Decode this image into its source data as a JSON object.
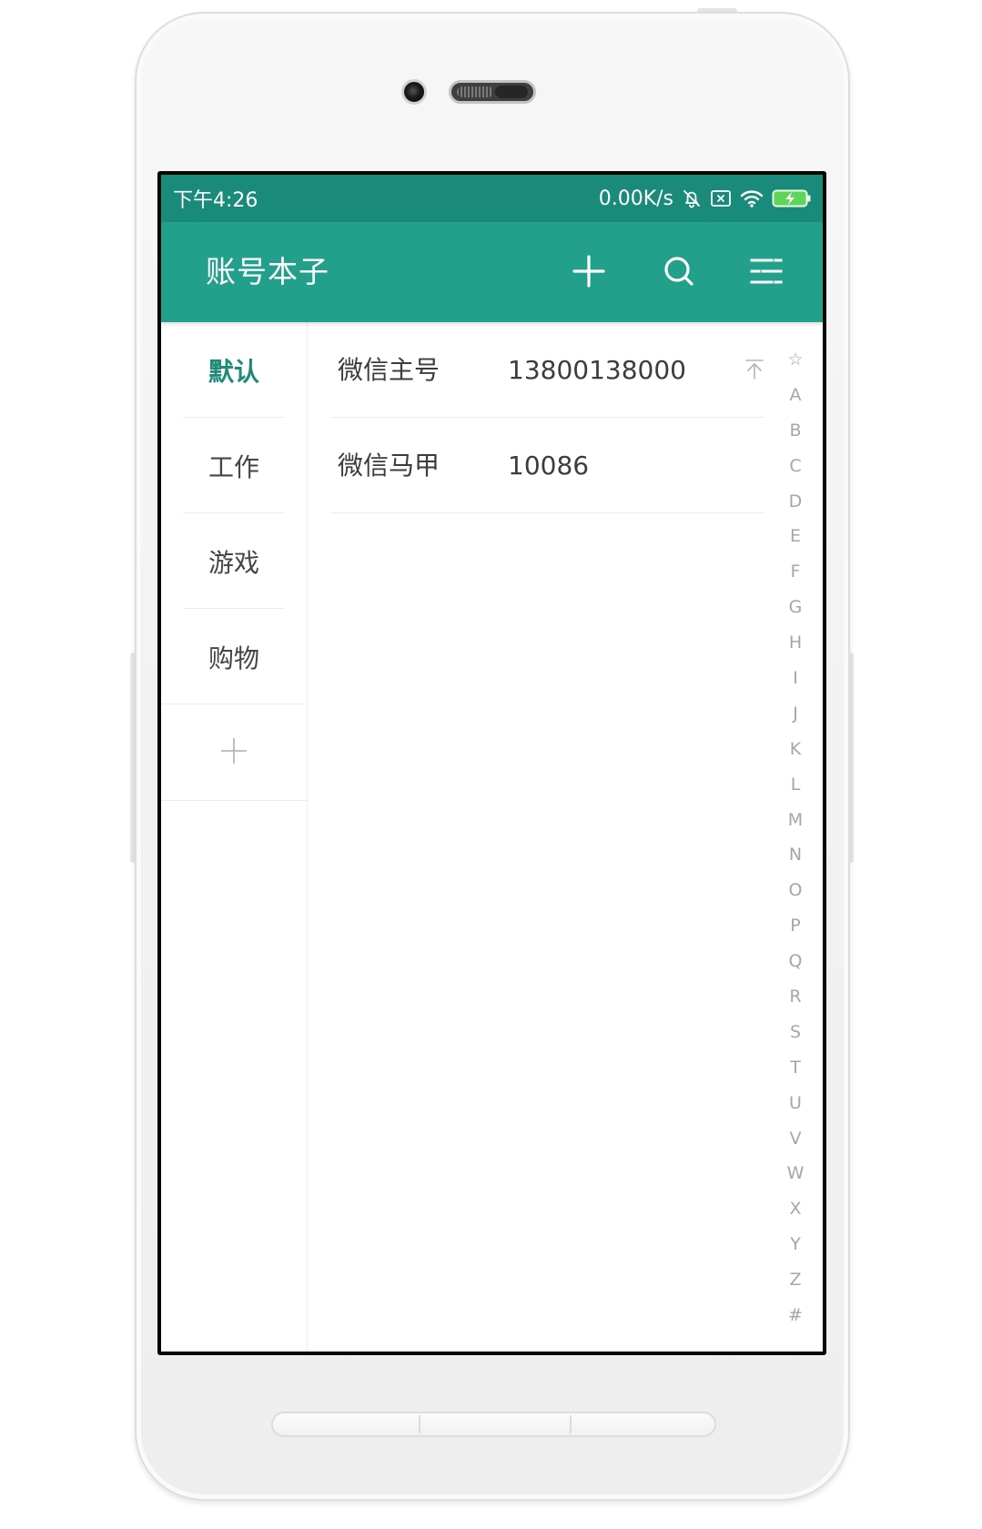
{
  "status_bar": {
    "time": "下午4:26",
    "net_speed": "0.00K/s",
    "icons": [
      "bell-muted-icon",
      "data-disabled-icon",
      "wifi-icon",
      "battery-charging-icon"
    ]
  },
  "app_bar": {
    "title": "账号本子",
    "actions": [
      "plus-icon",
      "search-icon",
      "filter-menu-icon"
    ]
  },
  "sidebar": {
    "categories": [
      {
        "label": "默认",
        "selected": true
      },
      {
        "label": "工作",
        "selected": false
      },
      {
        "label": "游戏",
        "selected": false
      },
      {
        "label": "购物",
        "selected": false
      }
    ],
    "add_icon": "plus-icon"
  },
  "accounts": [
    {
      "name": "微信主号",
      "account": "13800138000",
      "action_icon": "move-to-top-icon"
    },
    {
      "name": "微信马甲",
      "account": "10086"
    }
  ],
  "index_bar": [
    "☆",
    "A",
    "B",
    "C",
    "D",
    "E",
    "F",
    "G",
    "H",
    "I",
    "J",
    "K",
    "L",
    "M",
    "N",
    "O",
    "P",
    "Q",
    "R",
    "S",
    "T",
    "U",
    "V",
    "W",
    "X",
    "Y",
    "Z",
    "#"
  ],
  "colors": {
    "status_bar": "#1a8b7a",
    "app_bar": "#22a08b",
    "accent": "#1c8c79",
    "text": "#3c3c3c",
    "index_text": "#a6a6a6"
  }
}
